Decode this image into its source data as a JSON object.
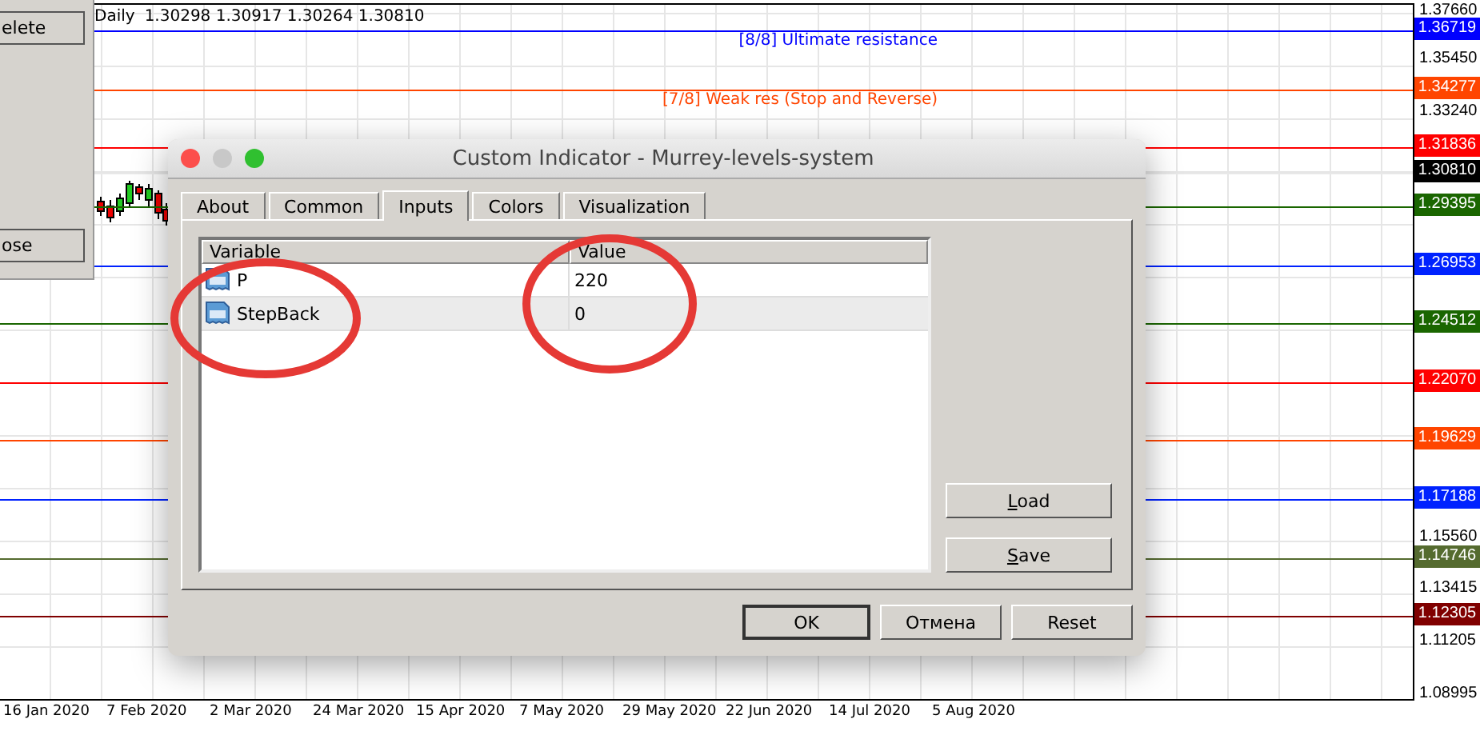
{
  "side_panel": {
    "buttons": [
      "elete",
      "ose"
    ]
  },
  "chart": {
    "timeframe": "Daily",
    "quote": "1.30298 1.30917 1.30264 1.30810",
    "levels": [
      {
        "price": "1.36719",
        "color": "#0000ff",
        "label": "[8/8] Ultimate resistance"
      },
      {
        "price": "1.34277",
        "color": "#ff4500",
        "label": "[7/8] Weak res (Stop and Reverse)"
      },
      {
        "price": "1.31836",
        "color": "#ff0000"
      },
      {
        "price": "1.29395",
        "color": "#1a6600"
      },
      {
        "price": "1.26953",
        "color": "#0022ff"
      },
      {
        "price": "1.24512",
        "color": "#1a6600"
      },
      {
        "price": "1.22070",
        "color": "#ff0000"
      },
      {
        "price": "1.19629",
        "color": "#ff4500"
      },
      {
        "price": "1.17188",
        "color": "#0022ff"
      },
      {
        "price": "1.14746",
        "color": "#556b2f"
      },
      {
        "price": "1.12305",
        "color": "#800000"
      }
    ],
    "current_price": "1.30810",
    "price_ticks": [
      "1.37660",
      "1.35450",
      "1.33240",
      "1.15560",
      "1.13415",
      "1.11205",
      "1.08995"
    ],
    "dates": [
      "16 Jan 2020",
      "7 Feb 2020",
      "2 Mar 2020",
      "24 Mar 2020",
      "15 Apr 2020",
      "7 May 2020",
      "29 May 2020",
      "22 Jun 2020",
      "14 Jul 2020",
      "5 Aug 2020"
    ]
  },
  "dialog": {
    "title": "Custom Indicator - Murrey-levels-system",
    "tabs": [
      {
        "label": "About",
        "selected": false
      },
      {
        "label": "Common",
        "selected": false
      },
      {
        "label": "Inputs",
        "selected": true
      },
      {
        "label": "Colors",
        "selected": false
      },
      {
        "label": "Visualization",
        "selected": false
      }
    ],
    "columns": [
      "Variable",
      "Value"
    ],
    "rows": [
      {
        "variable": "P",
        "value": "220",
        "selected": false
      },
      {
        "variable": "StepBack",
        "value": "0",
        "selected": true
      }
    ],
    "side_buttons": [
      "Load",
      "Save"
    ],
    "buttons": [
      "OK",
      "Отмена",
      "Reset"
    ]
  }
}
